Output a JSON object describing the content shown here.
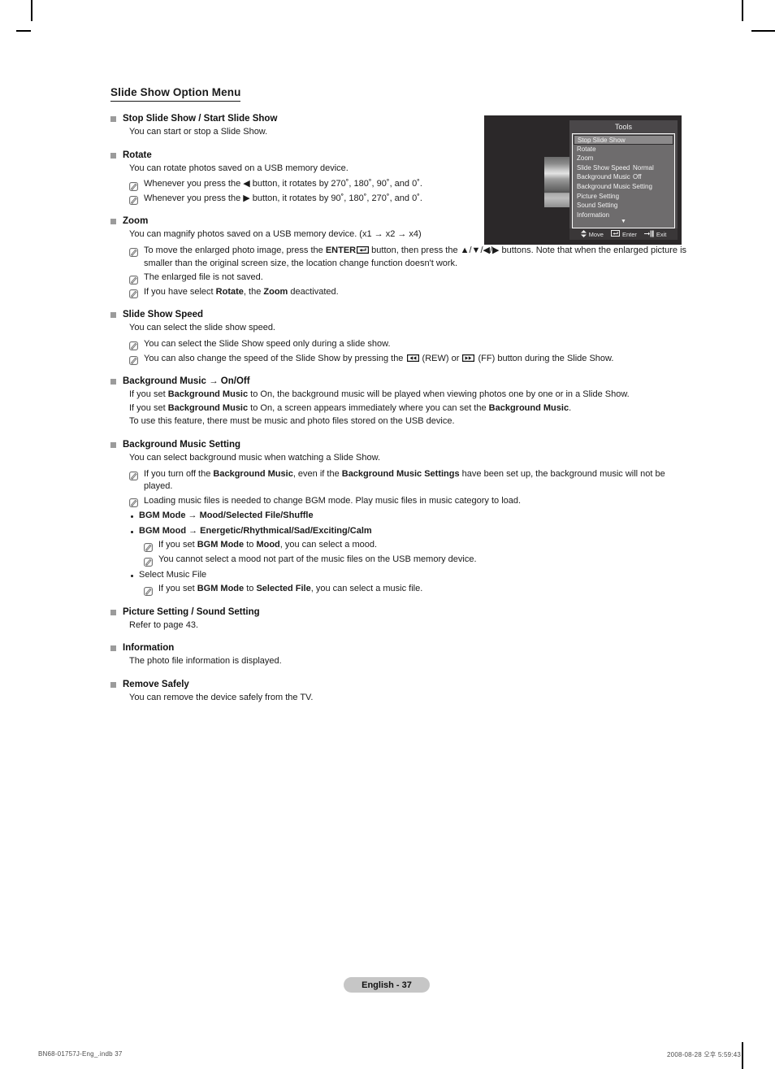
{
  "section": {
    "title": "Slide Show Option Menu"
  },
  "entries": [
    {
      "title": "Stop Slide Show / Start Slide Show",
      "paras": [
        "You can start or stop a Slide Show."
      ],
      "notes": [],
      "dots": []
    },
    {
      "title": "Rotate",
      "paras": [
        "You can rotate photos saved on a USB memory device."
      ],
      "notes": [
        "Whenever you press the ◀ button, it rotates by 270˚, 180˚, 90˚, and 0˚.",
        "Whenever you press the ▶ button, it rotates by 90˚, 180˚, 270˚, and 0˚."
      ],
      "dots": []
    },
    {
      "title": "Zoom",
      "paras": [
        "You can magnify photos saved on a USB memory device. (x1 → x2 → x4)"
      ],
      "notes": [
        "To move the enlarged photo image, press the ENTER button, then press the ▲/▼/◀/▶ buttons.  Note that when the enlarged picture is smaller than the original screen size, the location change function doesn't work.",
        "The enlarged file is not saved.",
        "If you have select Rotate, the Zoom deactivated."
      ],
      "dots": []
    },
    {
      "title": "Slide Show Speed",
      "paras": [
        "You can select the slide show speed."
      ],
      "notes": [
        "You can select the Slide Show speed only during a slide show.",
        "You can also change the speed of the Slide Show by pressing the (REW) or (FF) button during the Slide Show."
      ],
      "dots": []
    },
    {
      "title": "Background Music → On/Off",
      "paras": [
        "If you set Background Music to On, the background music will be played when viewing photos one by one or in a Slide Show.",
        "If you set Background Music to On, a screen appears immediately where you can set the Background Music.",
        "To use this feature, there must be music and photo files stored on the USB device."
      ],
      "notes": [],
      "dots": []
    },
    {
      "title": "Background Music Setting",
      "paras": [
        "You can select background music when watching a Slide Show."
      ],
      "notes": [
        "If you turn off the Background Music, even if the Background Music Settings have been set up, the background music will not be played.",
        "Loading music files is needed to change BGM mode. Play music files in music category to load."
      ],
      "dots": [
        {
          "text": "BGM Mode → Mood/Selected File/Shuffle",
          "bold": true,
          "notes": []
        },
        {
          "text": "BGM Mood → Energetic/Rhythmical/Sad/Exciting/Calm",
          "bold": true,
          "notes": [
            "If you set BGM Mode to Mood, you can select a mood.",
            "You cannot select a mood not part of the music files on the USB memory device."
          ]
        },
        {
          "text": "Select Music File",
          "bold": false,
          "notes": [
            "If you set BGM Mode to Selected File, you can select a music file."
          ]
        }
      ]
    },
    {
      "title": "Picture Setting / Sound Setting",
      "paras": [
        "Refer to page 43."
      ],
      "notes": [],
      "dots": []
    },
    {
      "title": "Information",
      "paras": [
        "The photo file information is displayed."
      ],
      "notes": [],
      "dots": []
    },
    {
      "title": "Remove Safely",
      "paras": [
        "You can remove the device safely from the TV."
      ],
      "notes": [],
      "dots": []
    }
  ],
  "osd": {
    "title": "Tools",
    "items": [
      {
        "label": "Stop Slide Show",
        "value": "",
        "colon": "",
        "selected": true
      },
      {
        "label": "Rotate",
        "value": "",
        "colon": "",
        "selected": false
      },
      {
        "label": "Zoom",
        "value": "",
        "colon": "",
        "selected": false
      },
      {
        "label": "Slide Show Speed",
        "value": "Normal",
        "colon": ":",
        "selected": false
      },
      {
        "label": "Background Music",
        "value": "Off",
        "colon": ":",
        "selected": false
      },
      {
        "label": "Background Music Setting",
        "value": "",
        "colon": "",
        "selected": false
      },
      {
        "label": "Picture Setting",
        "value": "",
        "colon": "",
        "selected": false
      },
      {
        "label": "Sound Setting",
        "value": "",
        "colon": "",
        "selected": false
      },
      {
        "label": "Information",
        "value": "",
        "colon": "",
        "selected": false
      }
    ],
    "more_indicator": "▼",
    "bar": {
      "move": "Move",
      "enter": "Enter",
      "exit": "Exit"
    }
  },
  "footer": {
    "page_badge": "English - 37",
    "print_left": "BN68-01757J-Eng_.indb   37",
    "print_right": "2008-08-28   오후 5:59:43"
  },
  "colors": {
    "bullet": "#9b9b9b",
    "badge_bg": "#c6c6c6",
    "osd_bg": "#2b2829",
    "osd_panel": "#4a4749",
    "osd_list": "#6e6c6d",
    "osd_selected": "#8c8a8b"
  }
}
